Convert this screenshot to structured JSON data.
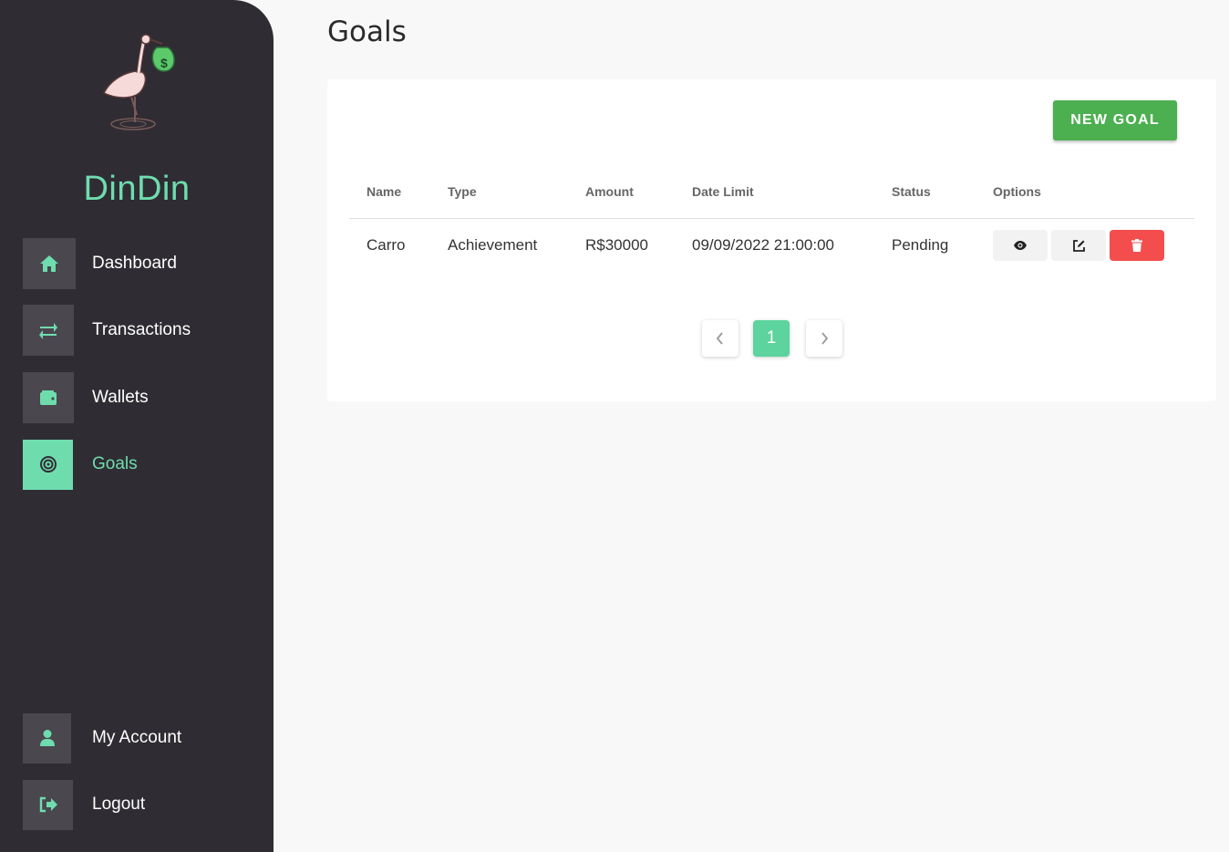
{
  "brand": {
    "name": "DinDin"
  },
  "sidebar": {
    "items": [
      {
        "label": "Dashboard",
        "icon": "home-icon"
      },
      {
        "label": "Transactions",
        "icon": "transfer-icon"
      },
      {
        "label": "Wallets",
        "icon": "wallet-icon"
      },
      {
        "label": "Goals",
        "icon": "target-icon",
        "active": true
      }
    ],
    "bottom": [
      {
        "label": "My Account",
        "icon": "user-icon"
      },
      {
        "label": "Logout",
        "icon": "logout-icon"
      }
    ]
  },
  "page": {
    "title": "Goals"
  },
  "toolbar": {
    "new_goal_label": "NEW GOAL"
  },
  "table": {
    "headers": [
      "Name",
      "Type",
      "Amount",
      "Date Limit",
      "Status",
      "Options"
    ],
    "rows": [
      {
        "name": "Carro",
        "type": "Achievement",
        "amount": "R$30000",
        "date_limit": "09/09/2022 21:00:00",
        "status": "Pending"
      }
    ]
  },
  "pagination": {
    "current": "1",
    "prev": "‹",
    "next": "›"
  },
  "colors": {
    "accent": "#6fdcae",
    "sidebar": "#2f2d33",
    "primary_button": "#4caf50",
    "danger": "#f44d4d"
  }
}
